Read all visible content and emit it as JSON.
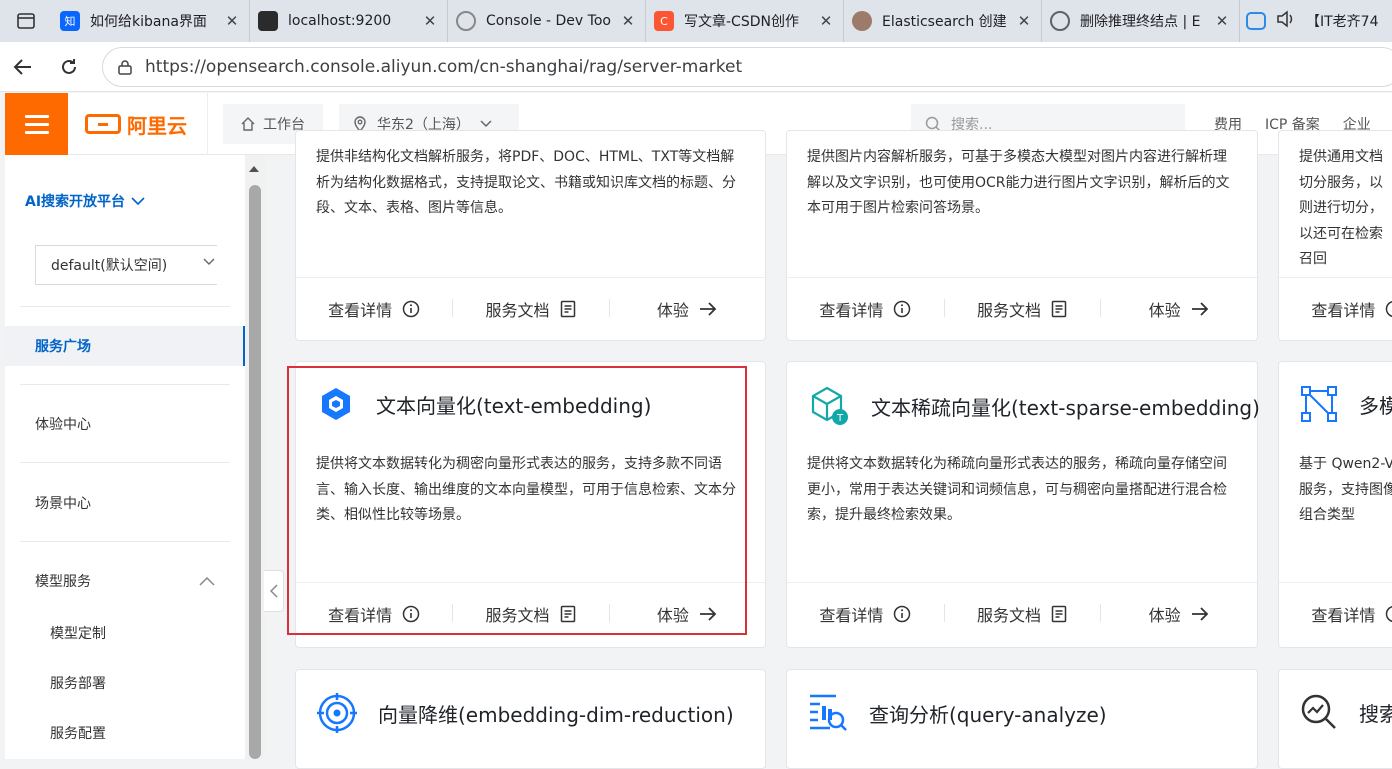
{
  "browser": {
    "tabs": [
      {
        "title": "如何给kibana界面",
        "icon": "zhihu-icon",
        "color": "#0a66ff",
        "glyph": "知"
      },
      {
        "title": "localhost:9200",
        "icon": "elastic-icon",
        "color": "#2b2b2b",
        "glyph": ""
      },
      {
        "title": "Console - Dev Too",
        "icon": "devtools-icon",
        "color": "#888888",
        "glyph": ""
      },
      {
        "title": "写文章-CSDN创作",
        "icon": "csdn-icon",
        "color": "#fc5531",
        "glyph": "C"
      },
      {
        "title": "Elasticsearch 创建",
        "icon": "avatar-icon",
        "color": "#9c7b6b",
        "glyph": ""
      },
      {
        "title": "删除推理终结点 | E",
        "icon": "globe-icon",
        "color": "#5f6368",
        "glyph": ""
      }
    ],
    "extra_tab_title": "【IT老齐74",
    "url": "https://opensearch.console.aliyun.com/cn-shanghai/rag/server-market"
  },
  "header": {
    "logo_text": "阿里云",
    "workbench": "工作台",
    "region": "华东2（上海）",
    "search_placeholder": "搜索...",
    "links": [
      "费用",
      "ICP 备案",
      "企业"
    ]
  },
  "sidebar": {
    "platform": "AI搜索开放平台",
    "namespace": "default(默认空间)",
    "items": [
      "服务广场",
      "体验中心",
      "场景中心",
      "模型服务"
    ],
    "sub_items": [
      "模型定制",
      "服务部署",
      "服务配置"
    ]
  },
  "cards": {
    "footer": {
      "details": "查看详情",
      "docs": "服务文档",
      "try": "体验"
    },
    "row1": [
      {
        "desc": "提供非结构化文档解析服务，将PDF、DOC、HTML、TXT等文档解析为结构化数据格式，支持提取论文、书籍或知识库文档的标题、分段、文本、表格、图片等信息。"
      },
      {
        "desc": "提供图片内容解析服务，可基于多模态大模型对图片内容进行解析理解以及文字识别，也可使用OCR能力进行图片文字识别，解析后的文本可用于图片检索问答场景。"
      },
      {
        "desc": "提供通用文档切分服务，以则进行切分，以还可在检索召回"
      }
    ],
    "row2": [
      {
        "title": "文本向量化(text-embedding)",
        "desc": "提供将文本数据转化为稠密向量形式表达的服务，支持多款不同语言、输入长度、输出维度的文本向量模型，可用于信息检索、文本分类、相似性比较等场景。"
      },
      {
        "title": "文本稀疏向量化(text-sparse-embedding)",
        "desc": "提供将文本数据转化为稀疏向量形式表达的服务，稀疏向量存储空间更小，常用于表达关键词和词频信息，可与稠密向量搭配进行混合检索，提升最终检索效果。"
      },
      {
        "title": "多模",
        "desc": "基于 Qwen2-V量服务，支持图像及组合类型"
      }
    ],
    "row3": [
      {
        "title": "向量降维(embedding-dim-reduction)"
      },
      {
        "title": "查询分析(query-analyze)"
      },
      {
        "title": "搜索"
      }
    ]
  },
  "colors": {
    "brand": "#ff6a00",
    "primary": "#0064c8",
    "highlight": "#d9303a"
  }
}
